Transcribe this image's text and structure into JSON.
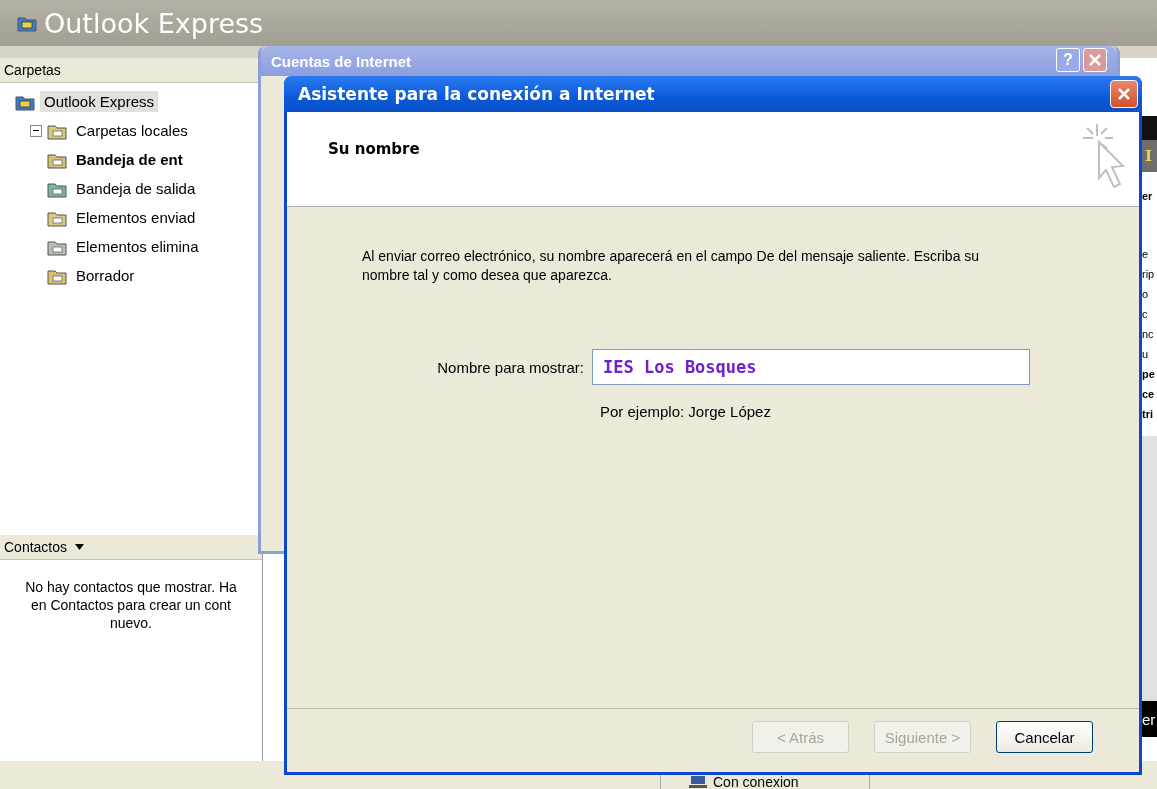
{
  "main_window": {
    "title": "Outlook Express"
  },
  "folders": {
    "header": "Carpetas",
    "tree": [
      {
        "label": "Outlook Express",
        "kind": "root",
        "selected": true,
        "unread": false,
        "children": [
          {
            "label": "Carpetas locales",
            "kind": "local",
            "selected": false,
            "unread": false,
            "expanded": true,
            "children": [
              {
                "label": "Bandeja de ent",
                "kind": "inbox",
                "selected": false,
                "unread": true
              },
              {
                "label": "Bandeja de salida",
                "kind": "outbox",
                "selected": false,
                "unread": false
              },
              {
                "label": "Elementos enviad",
                "kind": "sent",
                "selected": false,
                "unread": false
              },
              {
                "label": "Elementos elimina",
                "kind": "deleted",
                "selected": false,
                "unread": false
              },
              {
                "label": "Borrador",
                "kind": "drafts",
                "selected": false,
                "unread": false
              }
            ]
          }
        ]
      }
    ]
  },
  "contacts": {
    "header": "Contactos",
    "lines": [
      "No hay contactos que mostrar. Ha",
      "en Contactos para crear un cont",
      "nuevo."
    ]
  },
  "status_bar": {
    "connection": "Con conexion"
  },
  "preview_pane": {
    "header": "I",
    "lines": [
      {
        "text": "er",
        "bold": true
      },
      {
        "text": "e",
        "bold": false
      },
      {
        "text": "rip",
        "bold": false
      },
      {
        "text": "o",
        "bold": false
      },
      {
        "text": "c",
        "bold": false
      },
      {
        "text": "nc",
        "bold": false
      },
      {
        "text": "u",
        "bold": false
      },
      {
        "text": "pe",
        "bold": true
      },
      {
        "text": "ce",
        "bold": true
      },
      {
        "text": "tri",
        "bold": true
      }
    ],
    "footer": "er"
  },
  "accounts_dialog": {
    "title": "Cuentas de Internet",
    "help": "?"
  },
  "wizard": {
    "title": "Asistente para la conexión a Internet",
    "page_title": "Su nombre",
    "intro": "Al enviar correo electrónico, su nombre aparecerá en el campo De del mensaje saliente. Escriba su nombre tal y como desea que aparezca.",
    "field_label": "Nombre para mostrar:",
    "field_value": "IES Los Bosques",
    "example": "Por ejemplo: Jorge López",
    "buttons": [
      {
        "label": "< Atrás",
        "disabled": true
      },
      {
        "label": "Siguiente >",
        "disabled": true
      },
      {
        "label": "Cancelar",
        "disabled": false
      }
    ]
  }
}
